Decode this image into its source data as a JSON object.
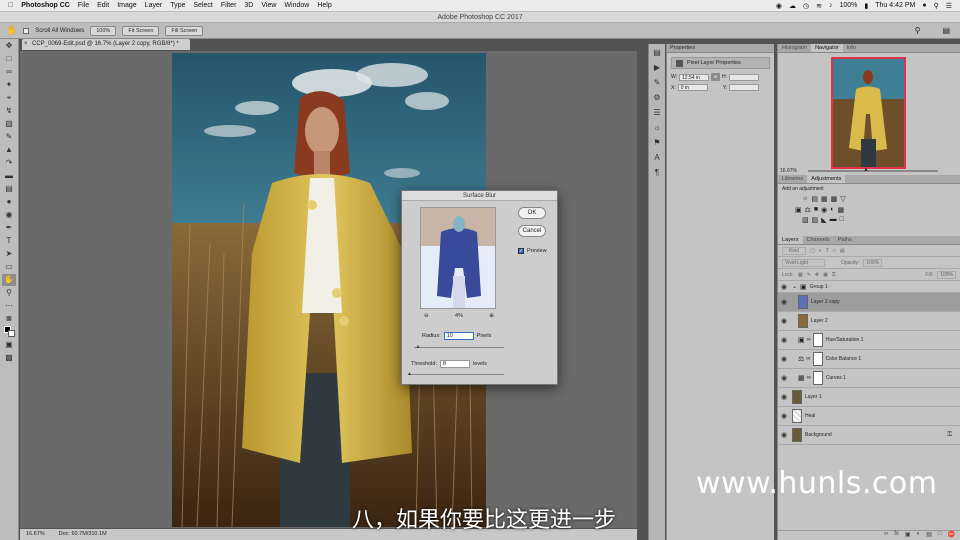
{
  "menubar": {
    "app_name": "Photoshop CC",
    "items": [
      "File",
      "Edit",
      "Image",
      "Layer",
      "Type",
      "Select",
      "Filter",
      "3D",
      "View",
      "Window",
      "Help"
    ],
    "battery": "100%",
    "clock": "Thu 4:42 PM"
  },
  "window_title": "Adobe Photoshop CC 2017",
  "options_bar": {
    "scroll_all": "Scroll All Windows",
    "zoom_100": "100%",
    "fit_screen": "Fit Screen",
    "fill_screen": "Fill Screen"
  },
  "document": {
    "tab_title": "CCP_0069-Edit.psd @ 16.7% (Layer 2 copy, RGB/8*) *",
    "zoom": "16.67%",
    "doc_size": "Doc: 60.7M/310.1M"
  },
  "properties": {
    "tab": "Properties",
    "header": "Pixel Layer Properties",
    "w_label": "W:",
    "w_value": "12.54 in",
    "h_label": "H:",
    "x_label": "X:",
    "x_value": "0 in",
    "y_label": "Y:"
  },
  "navigator": {
    "tabs": [
      "Histogram",
      "Navigator",
      "Info"
    ],
    "zoom": "16.67%"
  },
  "adjustments": {
    "tabs": [
      "Libraries",
      "Adjustments"
    ],
    "add_label": "Add an adjustment"
  },
  "layers_panel": {
    "tabs": [
      "Layers",
      "Channels",
      "Paths"
    ],
    "kind_label": "Kind",
    "blend_mode": "Vivid Light",
    "opacity_label": "Opacity:",
    "opacity_value": "100%",
    "lock_label": "Lock:",
    "fill_label": "Fill:",
    "fill_value": "100%",
    "layers": [
      {
        "name": "Group 1",
        "kind": "group"
      },
      {
        "name": "Layer 2 copy",
        "kind": "pixel",
        "selected": true
      },
      {
        "name": "Layer 2",
        "kind": "pixel"
      },
      {
        "name": "Hue/Saturation 1",
        "kind": "adjustment"
      },
      {
        "name": "Color Balance 1",
        "kind": "adjustment"
      },
      {
        "name": "Curves 1",
        "kind": "adjustment"
      },
      {
        "name": "Layer 1",
        "kind": "pixel"
      },
      {
        "name": "Heal",
        "kind": "empty"
      },
      {
        "name": "Background",
        "kind": "pixel"
      }
    ]
  },
  "surface_blur": {
    "title": "Surface Blur",
    "ok": "OK",
    "cancel": "Cancel",
    "preview": "Preview",
    "zoom_pct": "4%",
    "radius_label": "Radius:",
    "radius_value": "10",
    "radius_unit": "Pixels",
    "threshold_label": "Threshold:",
    "threshold_value": "8",
    "threshold_unit": "levels",
    "radius_level": 0.05,
    "threshold_level": 0.0
  },
  "watermark": "www.hunls.com",
  "subtitle": "八，如果你要比这更进一步",
  "colors": {
    "accent_red": "#e0304a",
    "sky": "#3d7890",
    "coat": "#d6b84a"
  }
}
